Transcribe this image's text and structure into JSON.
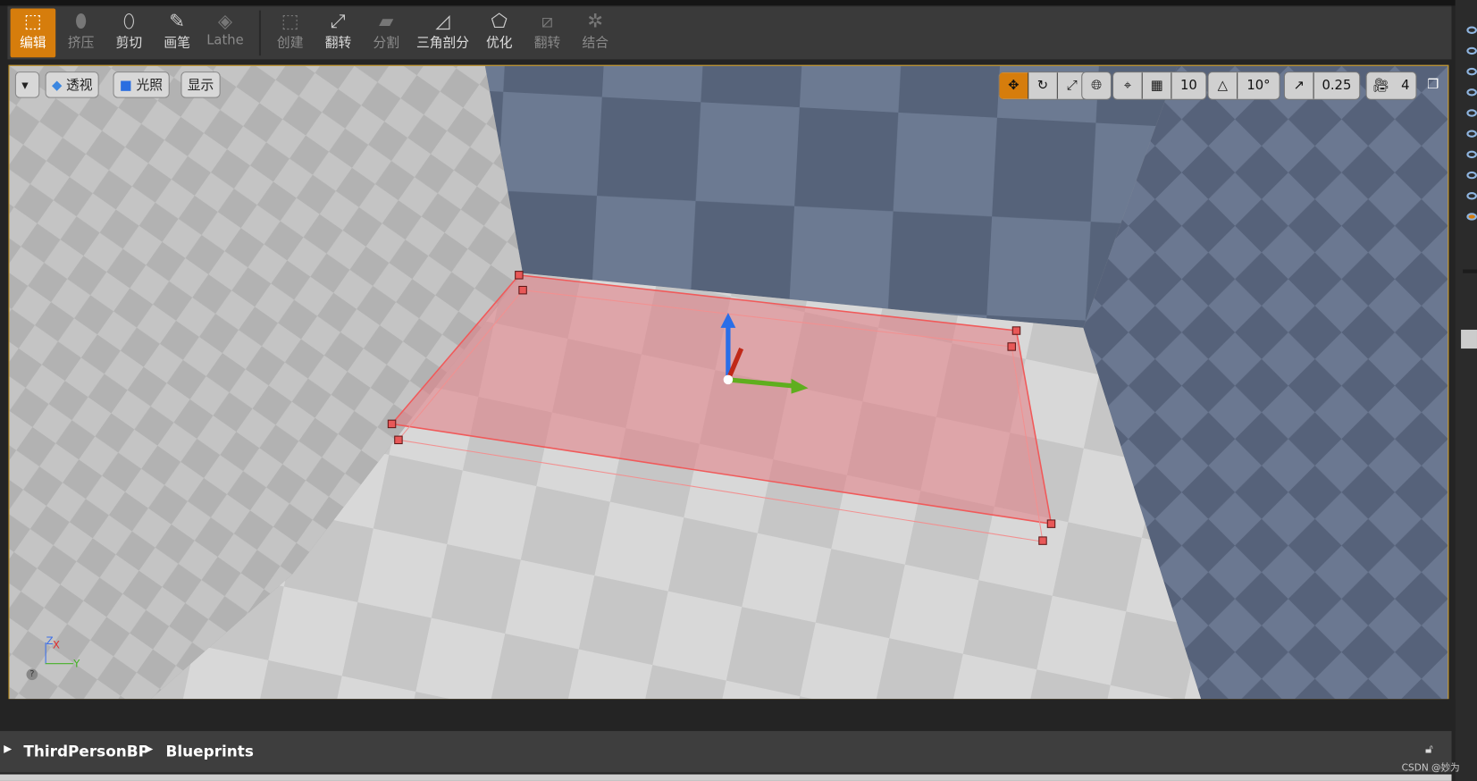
{
  "toolbar": {
    "tools": [
      {
        "label": "编辑",
        "icon": "select-edit-icon",
        "state": "active"
      },
      {
        "label": "挤压",
        "icon": "extrude-icon",
        "state": "disabled"
      },
      {
        "label": "剪切",
        "icon": "cut-icon",
        "state": "enabled"
      },
      {
        "label": "画笔",
        "icon": "pen-icon",
        "state": "enabled"
      },
      {
        "label": "Lathe",
        "icon": "lathe-icon",
        "state": "disabled"
      },
      {
        "label": "创建",
        "icon": "create-icon",
        "state": "disabled"
      },
      {
        "label": "翻转",
        "icon": "flip-icon",
        "state": "enabled"
      },
      {
        "label": "分割",
        "icon": "split-icon",
        "state": "disabled"
      },
      {
        "label": "三角剖分",
        "icon": "triangulate-icon",
        "state": "enabled"
      },
      {
        "label": "优化",
        "icon": "optimize-icon",
        "state": "enabled"
      },
      {
        "label": "翻转",
        "icon": "turn-icon",
        "state": "disabled"
      },
      {
        "label": "结合",
        "icon": "weld-icon",
        "state": "disabled"
      }
    ]
  },
  "viewport": {
    "perspective_label": "透视",
    "lighting_label": "光照",
    "show_label": "显示",
    "grid_snap": "10",
    "rotation_snap": "10°",
    "scale_snap": "0.25",
    "camera_speed": "4",
    "accent": "#d67d0c",
    "border": "#c8951a",
    "axis": {
      "z": "Z",
      "x": "X",
      "y": "Y"
    }
  },
  "path": {
    "items": [
      "ThirdPersonBP",
      "Blueprints"
    ]
  },
  "watermark": "CSDN @妙为"
}
